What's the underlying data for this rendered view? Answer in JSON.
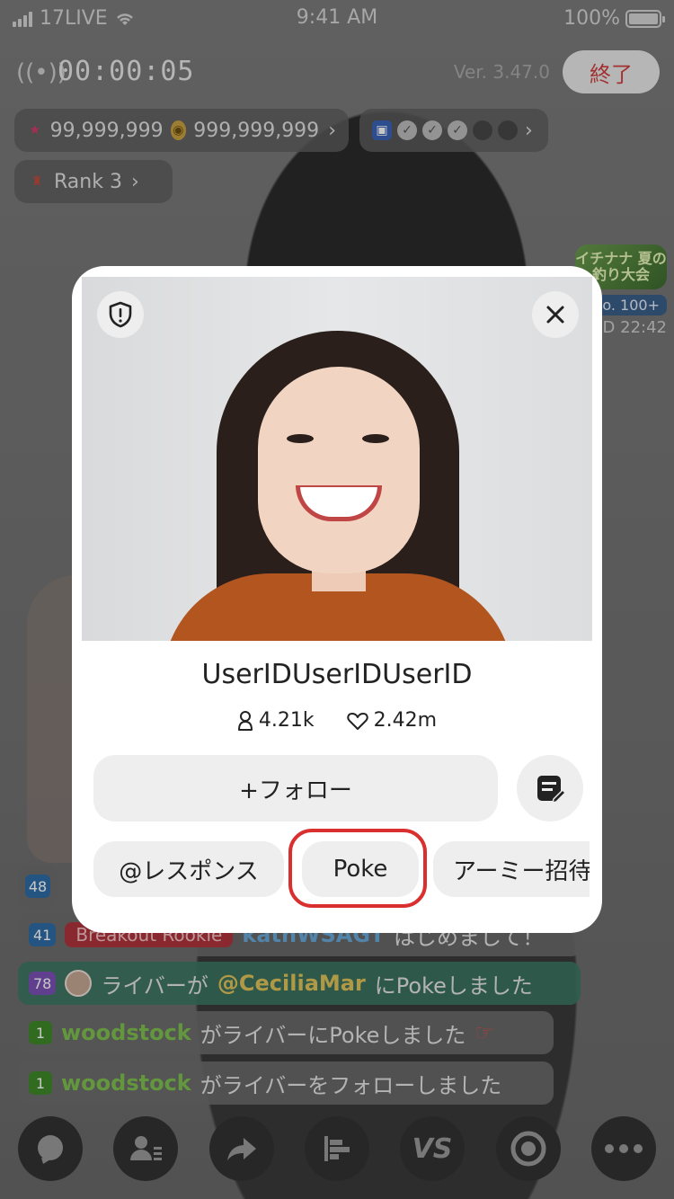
{
  "status_bar": {
    "carrier": "17LIVE",
    "time": "9:41 AM",
    "battery": "100%",
    "battery_level": 1.0
  },
  "header": {
    "timer": "00:00:05",
    "version": "Ver. 3.47.0",
    "end_label": "終了"
  },
  "stats_pill": {
    "points": "99,999,999",
    "coins": "999,999,999"
  },
  "rank_pill": {
    "label": "Rank 3"
  },
  "event_banner": {
    "title": "イチナナ 夏の釣り大会",
    "rank": "No. 100+",
    "time": "OD 22:42"
  },
  "chat": [
    {
      "level": "48",
      "text": ""
    },
    {
      "level": "41",
      "badge": "Breakout Rookie",
      "user": "kathWSAGT",
      "text": "はじめまして！"
    },
    {
      "level": "78",
      "prefix": "ライバーが",
      "mention": "@CeciliaMar",
      "suffix": "にPokeしました"
    },
    {
      "level": "1",
      "user": "woodstock",
      "text": "がライバーにPokeしました"
    },
    {
      "level": "1",
      "user": "woodstock",
      "text": "がライバーをフォローしました"
    }
  ],
  "profile": {
    "username": "UserIDUserIDUserID",
    "followers": "4.21k",
    "likes": "2.42m",
    "follow_label": "+フォロー",
    "actions": [
      "@レスポンス",
      "Poke",
      "アーミー招待"
    ]
  },
  "toolbar": {
    "vs_label": "VS"
  },
  "colors": {
    "highlight": "#d92f2f",
    "end_text": "#d04040",
    "username_green": "#7fc24f",
    "mention_gold": "#e2c45a"
  }
}
